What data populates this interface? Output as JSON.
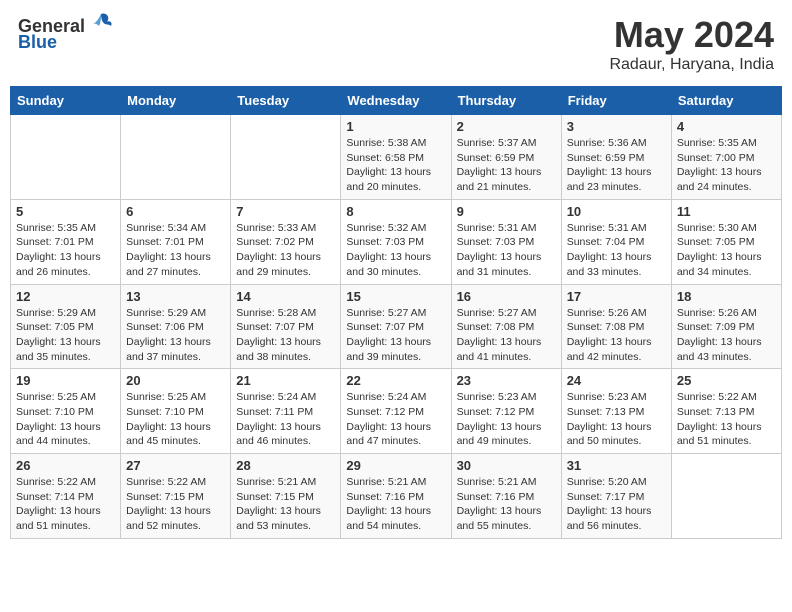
{
  "header": {
    "logo_general": "General",
    "logo_blue": "Blue",
    "month": "May 2024",
    "location": "Radaur, Haryana, India"
  },
  "weekdays": [
    "Sunday",
    "Monday",
    "Tuesday",
    "Wednesday",
    "Thursday",
    "Friday",
    "Saturday"
  ],
  "weeks": [
    [
      {
        "day": "",
        "info": ""
      },
      {
        "day": "",
        "info": ""
      },
      {
        "day": "",
        "info": ""
      },
      {
        "day": "1",
        "info": "Sunrise: 5:38 AM\nSunset: 6:58 PM\nDaylight: 13 hours\nand 20 minutes."
      },
      {
        "day": "2",
        "info": "Sunrise: 5:37 AM\nSunset: 6:59 PM\nDaylight: 13 hours\nand 21 minutes."
      },
      {
        "day": "3",
        "info": "Sunrise: 5:36 AM\nSunset: 6:59 PM\nDaylight: 13 hours\nand 23 minutes."
      },
      {
        "day": "4",
        "info": "Sunrise: 5:35 AM\nSunset: 7:00 PM\nDaylight: 13 hours\nand 24 minutes."
      }
    ],
    [
      {
        "day": "5",
        "info": "Sunrise: 5:35 AM\nSunset: 7:01 PM\nDaylight: 13 hours\nand 26 minutes."
      },
      {
        "day": "6",
        "info": "Sunrise: 5:34 AM\nSunset: 7:01 PM\nDaylight: 13 hours\nand 27 minutes."
      },
      {
        "day": "7",
        "info": "Sunrise: 5:33 AM\nSunset: 7:02 PM\nDaylight: 13 hours\nand 29 minutes."
      },
      {
        "day": "8",
        "info": "Sunrise: 5:32 AM\nSunset: 7:03 PM\nDaylight: 13 hours\nand 30 minutes."
      },
      {
        "day": "9",
        "info": "Sunrise: 5:31 AM\nSunset: 7:03 PM\nDaylight: 13 hours\nand 31 minutes."
      },
      {
        "day": "10",
        "info": "Sunrise: 5:31 AM\nSunset: 7:04 PM\nDaylight: 13 hours\nand 33 minutes."
      },
      {
        "day": "11",
        "info": "Sunrise: 5:30 AM\nSunset: 7:05 PM\nDaylight: 13 hours\nand 34 minutes."
      }
    ],
    [
      {
        "day": "12",
        "info": "Sunrise: 5:29 AM\nSunset: 7:05 PM\nDaylight: 13 hours\nand 35 minutes."
      },
      {
        "day": "13",
        "info": "Sunrise: 5:29 AM\nSunset: 7:06 PM\nDaylight: 13 hours\nand 37 minutes."
      },
      {
        "day": "14",
        "info": "Sunrise: 5:28 AM\nSunset: 7:07 PM\nDaylight: 13 hours\nand 38 minutes."
      },
      {
        "day": "15",
        "info": "Sunrise: 5:27 AM\nSunset: 7:07 PM\nDaylight: 13 hours\nand 39 minutes."
      },
      {
        "day": "16",
        "info": "Sunrise: 5:27 AM\nSunset: 7:08 PM\nDaylight: 13 hours\nand 41 minutes."
      },
      {
        "day": "17",
        "info": "Sunrise: 5:26 AM\nSunset: 7:08 PM\nDaylight: 13 hours\nand 42 minutes."
      },
      {
        "day": "18",
        "info": "Sunrise: 5:26 AM\nSunset: 7:09 PM\nDaylight: 13 hours\nand 43 minutes."
      }
    ],
    [
      {
        "day": "19",
        "info": "Sunrise: 5:25 AM\nSunset: 7:10 PM\nDaylight: 13 hours\nand 44 minutes."
      },
      {
        "day": "20",
        "info": "Sunrise: 5:25 AM\nSunset: 7:10 PM\nDaylight: 13 hours\nand 45 minutes."
      },
      {
        "day": "21",
        "info": "Sunrise: 5:24 AM\nSunset: 7:11 PM\nDaylight: 13 hours\nand 46 minutes."
      },
      {
        "day": "22",
        "info": "Sunrise: 5:24 AM\nSunset: 7:12 PM\nDaylight: 13 hours\nand 47 minutes."
      },
      {
        "day": "23",
        "info": "Sunrise: 5:23 AM\nSunset: 7:12 PM\nDaylight: 13 hours\nand 49 minutes."
      },
      {
        "day": "24",
        "info": "Sunrise: 5:23 AM\nSunset: 7:13 PM\nDaylight: 13 hours\nand 50 minutes."
      },
      {
        "day": "25",
        "info": "Sunrise: 5:22 AM\nSunset: 7:13 PM\nDaylight: 13 hours\nand 51 minutes."
      }
    ],
    [
      {
        "day": "26",
        "info": "Sunrise: 5:22 AM\nSunset: 7:14 PM\nDaylight: 13 hours\nand 51 minutes."
      },
      {
        "day": "27",
        "info": "Sunrise: 5:22 AM\nSunset: 7:15 PM\nDaylight: 13 hours\nand 52 minutes."
      },
      {
        "day": "28",
        "info": "Sunrise: 5:21 AM\nSunset: 7:15 PM\nDaylight: 13 hours\nand 53 minutes."
      },
      {
        "day": "29",
        "info": "Sunrise: 5:21 AM\nSunset: 7:16 PM\nDaylight: 13 hours\nand 54 minutes."
      },
      {
        "day": "30",
        "info": "Sunrise: 5:21 AM\nSunset: 7:16 PM\nDaylight: 13 hours\nand 55 minutes."
      },
      {
        "day": "31",
        "info": "Sunrise: 5:20 AM\nSunset: 7:17 PM\nDaylight: 13 hours\nand 56 minutes."
      },
      {
        "day": "",
        "info": ""
      }
    ]
  ]
}
